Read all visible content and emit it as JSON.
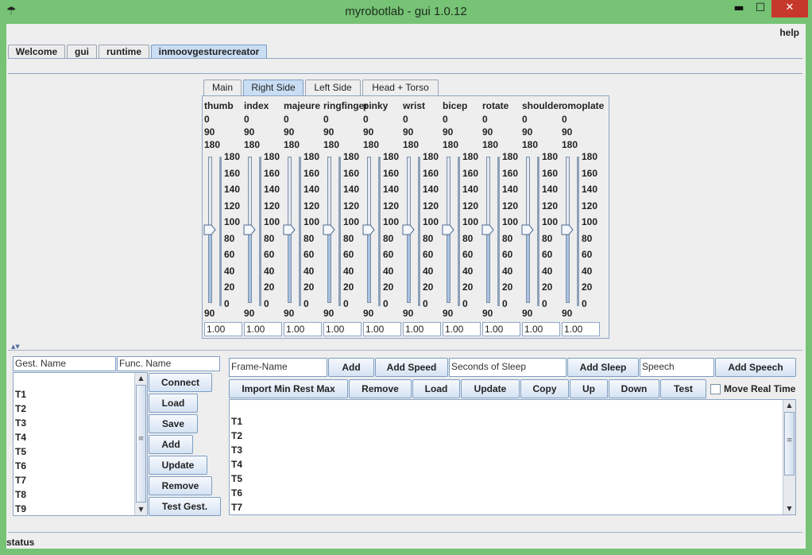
{
  "window": {
    "title": "myrobotlab - gui 1.0.12",
    "minimize_glyph": "▬",
    "maximize_glyph": "☐",
    "close_glyph": "✕",
    "app_icon": "robot-icon"
  },
  "menu": {
    "help": "help"
  },
  "tabs": [
    {
      "label": "Welcome"
    },
    {
      "label": "gui"
    },
    {
      "label": "runtime"
    },
    {
      "label": "inmoovgesturecreator"
    }
  ],
  "selected_tab": "inmoovgesturecreator",
  "subtabs": [
    {
      "label": "Main"
    },
    {
      "label": "Right Side"
    },
    {
      "label": "Left Side"
    },
    {
      "label": "Head + Torso"
    }
  ],
  "selected_subtab": "Right Side",
  "scale_labels": [
    "180",
    "160",
    "140",
    "120",
    "100",
    "80",
    "60",
    "40",
    "20",
    "0"
  ],
  "sliders": [
    {
      "name": "thumb",
      "min": "0",
      "mid": "90",
      "max": "180",
      "value": 90,
      "current": "90",
      "speed": "1.00"
    },
    {
      "name": "index",
      "min": "0",
      "mid": "90",
      "max": "180",
      "value": 90,
      "current": "90",
      "speed": "1.00"
    },
    {
      "name": "majeure",
      "min": "0",
      "mid": "90",
      "max": "180",
      "value": 90,
      "current": "90",
      "speed": "1.00"
    },
    {
      "name": "ringfinger",
      "min": "0",
      "mid": "90",
      "max": "180",
      "value": 90,
      "current": "90",
      "speed": "1.00"
    },
    {
      "name": "pinky",
      "min": "0",
      "mid": "90",
      "max": "180",
      "value": 90,
      "current": "90",
      "speed": "1.00"
    },
    {
      "name": "wrist",
      "min": "0",
      "mid": "90",
      "max": "180",
      "value": 90,
      "current": "90",
      "speed": "1.00"
    },
    {
      "name": "bicep",
      "min": "0",
      "mid": "90",
      "max": "180",
      "value": 90,
      "current": "90",
      "speed": "1.00"
    },
    {
      "name": "rotate",
      "min": "0",
      "mid": "90",
      "max": "180",
      "value": 90,
      "current": "90",
      "speed": "1.00"
    },
    {
      "name": "shoulder",
      "min": "0",
      "mid": "90",
      "max": "180",
      "value": 90,
      "current": "90",
      "speed": "1.00"
    },
    {
      "name": "omoplate",
      "min": "0",
      "mid": "90",
      "max": "180",
      "value": 90,
      "current": "90",
      "speed": "1.00"
    }
  ],
  "gesture": {
    "name_field": "Gest. Name",
    "func_field": "Func. Name",
    "buttons": [
      "Connect",
      "Load",
      "Save",
      "Add",
      "Update",
      "Remove",
      "Test Gest."
    ],
    "list": [
      "T1",
      "T2",
      "T3",
      "T4",
      "T5",
      "T6",
      "T7",
      "T8",
      "T9"
    ]
  },
  "frame": {
    "name_field": "Frame-Name",
    "add": "Add",
    "add_speed": "Add Speed",
    "sleep_field": "Seconds of Sleep",
    "add_sleep": "Add Sleep",
    "speech_field": "Speech",
    "add_speech": "Add Speech",
    "row2": [
      "Import Min Rest Max",
      "Remove",
      "Load",
      "Update",
      "Copy",
      "Up",
      "Down",
      "Test"
    ],
    "move_real_time": "Move Real Time",
    "move_real_time_checked": false,
    "list": [
      "T1",
      "T2",
      "T3",
      "T4",
      "T5",
      "T6",
      "T7"
    ]
  },
  "status": "status",
  "colors": {
    "accent": "#c9ddf3",
    "titlebar": "#76c375",
    "close": "#c7382c"
  }
}
